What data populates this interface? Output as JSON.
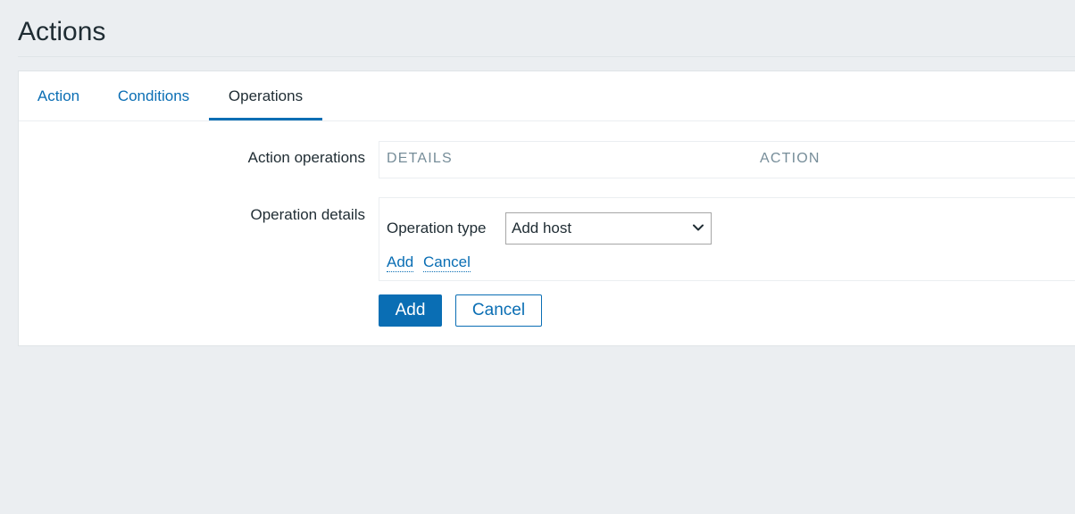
{
  "page": {
    "title": "Actions"
  },
  "tabs": [
    {
      "label": "Action",
      "active": false
    },
    {
      "label": "Conditions",
      "active": false
    },
    {
      "label": "Operations",
      "active": true
    }
  ],
  "form": {
    "action_operations_label": "Action operations",
    "operations_table": {
      "columns": [
        "DETAILS",
        "ACTION"
      ]
    },
    "operation_details_label": "Operation details",
    "operation_type": {
      "label": "Operation type",
      "selected": "Add host"
    },
    "inline_links": {
      "add": "Add",
      "cancel": "Cancel"
    },
    "buttons": {
      "add": "Add",
      "cancel": "Cancel"
    }
  },
  "colors": {
    "accent": "#0a6eb4",
    "background": "#ebeef1",
    "panel": "#ffffff",
    "muted_header": "#768d99"
  }
}
